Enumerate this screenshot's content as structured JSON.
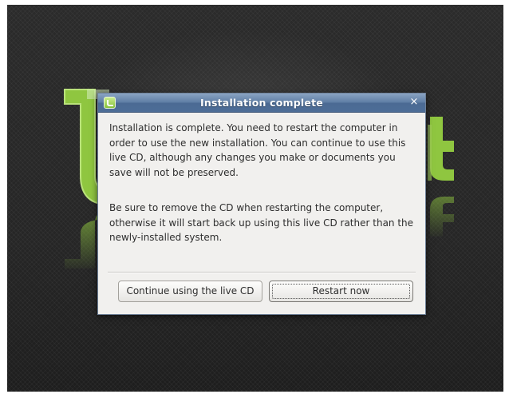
{
  "dialog": {
    "title": "Installation complete",
    "close_glyph": "×",
    "app_icon": "mint-icon",
    "message_1": "Installation is complete. You need to restart the computer in order to use the new installation. You can continue to use this live CD, although any changes you make or documents you save will not be preserved.",
    "message_2": "Be sure to remove the CD when restarting the computer, otherwise it will start back up using this live CD rather than the newly-installed system.",
    "buttons": {
      "continue_label": "Continue using the live CD",
      "restart_label": "Restart now"
    }
  },
  "background": {
    "logo_icon": "linux-mint-logo-icon",
    "colors": {
      "desktop": "#262626",
      "logo_green": "#8fc640",
      "titlebar": "#5f7ea5"
    }
  }
}
